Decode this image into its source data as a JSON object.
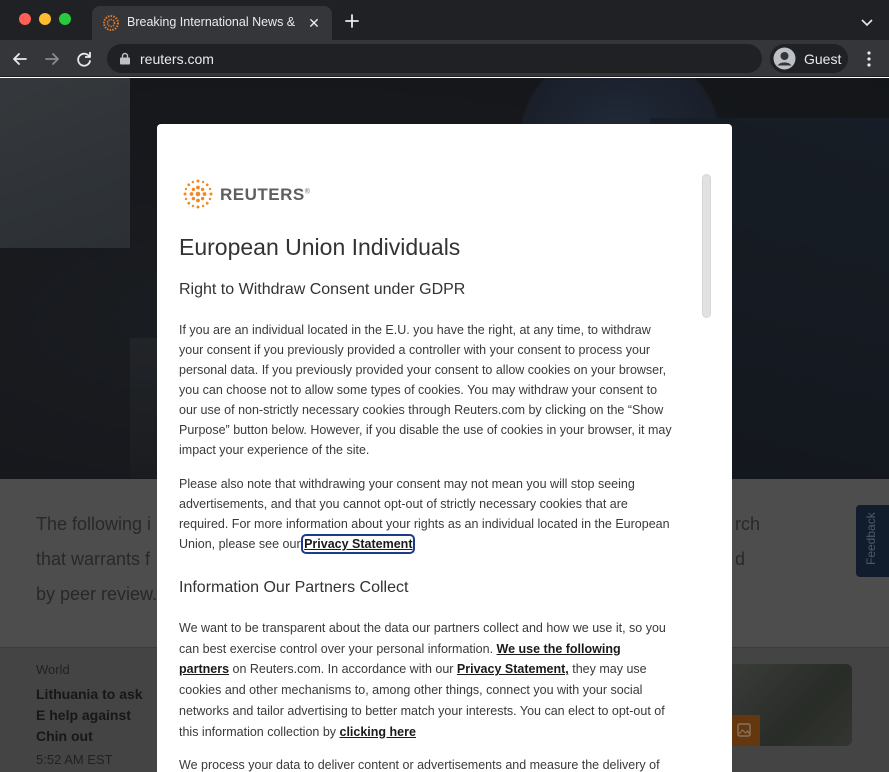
{
  "browser": {
    "tab_title": "Breaking International News &",
    "url": "reuters.com",
    "profile_name": "Guest"
  },
  "page": {
    "summary_lines": [
      "The following i",
      "that warrants f",
      "by peer review."
    ],
    "summary_right": [
      "rch",
      "d"
    ],
    "card": {
      "category": "World",
      "title": "Lithuania to ask E help against Chin out",
      "time": "5:52 AM EST"
    },
    "feedback_label": "Feedback"
  },
  "dialog": {
    "logo_text": "REUTERS",
    "title": "European Union Individuals",
    "subtitle": "Right to Withdraw Consent under GDPR",
    "p1": "If you are an individual located in the E.U. you have the right, at any time, to withdraw your consent if you previously provided a controller with your consent to process your personal data. If you previously provided your consent to allow cookies on your browser, you can choose not to allow some types of cookies. You may withdraw your consent to our use of non-strictly necessary cookies through Reuters.com by clicking on the “Show Purpose” button below. However, if you disable the use of cookies in your browser, it may impact your experience of the site.",
    "p2_text": "Please also note that withdrawing your consent may not mean you will stop seeing advertisements, and that you cannot opt-out of strictly necessary cookies that are required. For more information about your rights as an individual located in the European Union, please see our ",
    "p2_link": "Privacy Statement",
    "subtitle2": "Information Our Partners Collect",
    "p3_a": "We want to be transparent about the data our partners collect and how we use it, so you can best exercise control over your personal information. ",
    "p3_link1": "We use the following partners",
    "p3_b": " on Reuters.com. In accordance with our ",
    "p3_link2": "Privacy Statement,",
    "p3_c": " they may use cookies and other mechanisms to, among other things, connect you with your social networks and tailor advertising to better match your interests. You can elect to opt-out of this information collection by ",
    "p3_link3": "clicking here",
    "p4": "We process your data to deliver content or advertisements and measure the delivery of"
  }
}
